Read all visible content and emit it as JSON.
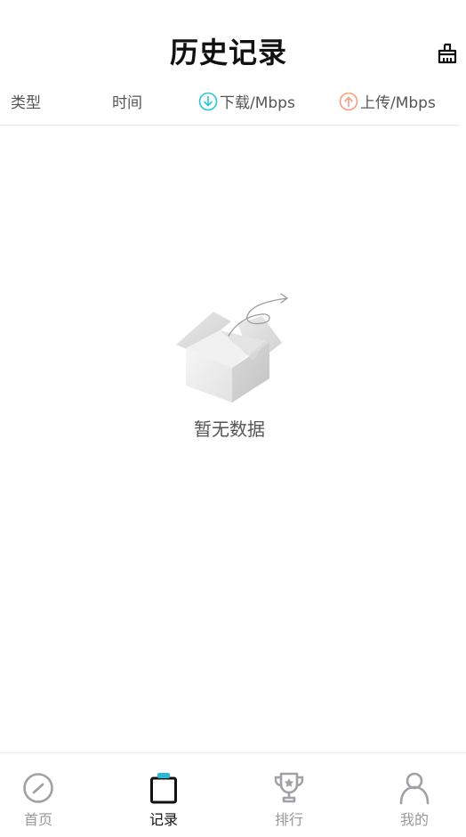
{
  "header": {
    "title": "历史记录",
    "clear_icon": "clear-brush-icon"
  },
  "columns": [
    {
      "label": "类型"
    },
    {
      "label": "时间"
    },
    {
      "label": "下载/Mbps",
      "icon": "download-circle-icon",
      "color": "#26c6da"
    },
    {
      "label": "上传/Mbps",
      "icon": "upload-circle-icon",
      "color": "#f0a080"
    }
  ],
  "empty_state": {
    "text": "暂无数据",
    "icon": "empty-box-icon"
  },
  "tabbar": {
    "active_color": "#111111",
    "accent": "#2bb8d4",
    "items": [
      {
        "label": "首页",
        "icon": "speedometer-icon"
      },
      {
        "label": "记录",
        "icon": "clipboard-icon"
      },
      {
        "label": "排行",
        "icon": "trophy-icon"
      },
      {
        "label": "我的",
        "icon": "user-icon"
      }
    ]
  }
}
